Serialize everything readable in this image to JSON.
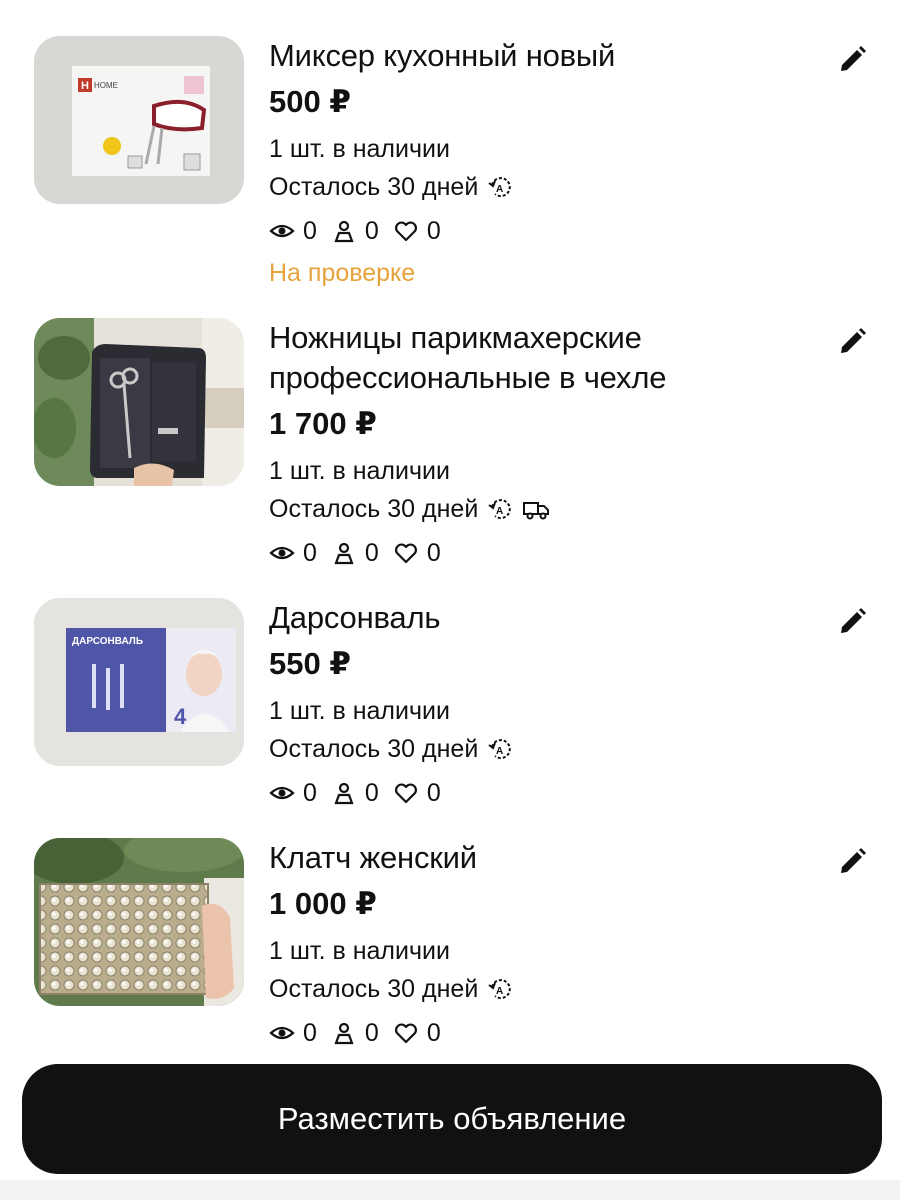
{
  "listings": [
    {
      "title": "Миксер кухонный новый",
      "price": "500 ₽",
      "stock": "1 шт. в наличии",
      "days_left": "Осталось 30 дней",
      "views": "0",
      "contacts": "0",
      "favorites": "0",
      "status": "На проверке",
      "image_text": "HOME"
    },
    {
      "title": "Ножницы парикмахерские профессиональные в чехле",
      "price": "1 700 ₽",
      "stock": "1 шт. в наличии",
      "days_left": "Осталось 30 дней",
      "views": "0",
      "contacts": "0",
      "favorites": "0",
      "delivery": true
    },
    {
      "title": "Дарсонваль",
      "price": "550 ₽",
      "stock": "1 шт. в наличии",
      "days_left": "Осталось 30 дней",
      "views": "0",
      "contacts": "0",
      "favorites": "0",
      "image_text": "ДАРСОНВАЛЬ",
      "image_number": "4"
    },
    {
      "title": "Клатч женский",
      "price": "1 000 ₽",
      "stock": "1 шт. в наличии",
      "days_left": "Осталось 30 дней",
      "views": "0",
      "contacts": "0",
      "favorites": "0"
    }
  ],
  "post_button_label": "Разместить объявление",
  "colors": {
    "status_pending": "#e8a23c",
    "button_bg": "#111111",
    "button_text": "#ffffff"
  },
  "icons": {
    "edit": "pencil-icon",
    "auto_renew": "auto-renew-icon",
    "delivery": "truck-icon",
    "views": "eye-icon",
    "contacts": "person-icon",
    "favorites": "heart-icon"
  }
}
